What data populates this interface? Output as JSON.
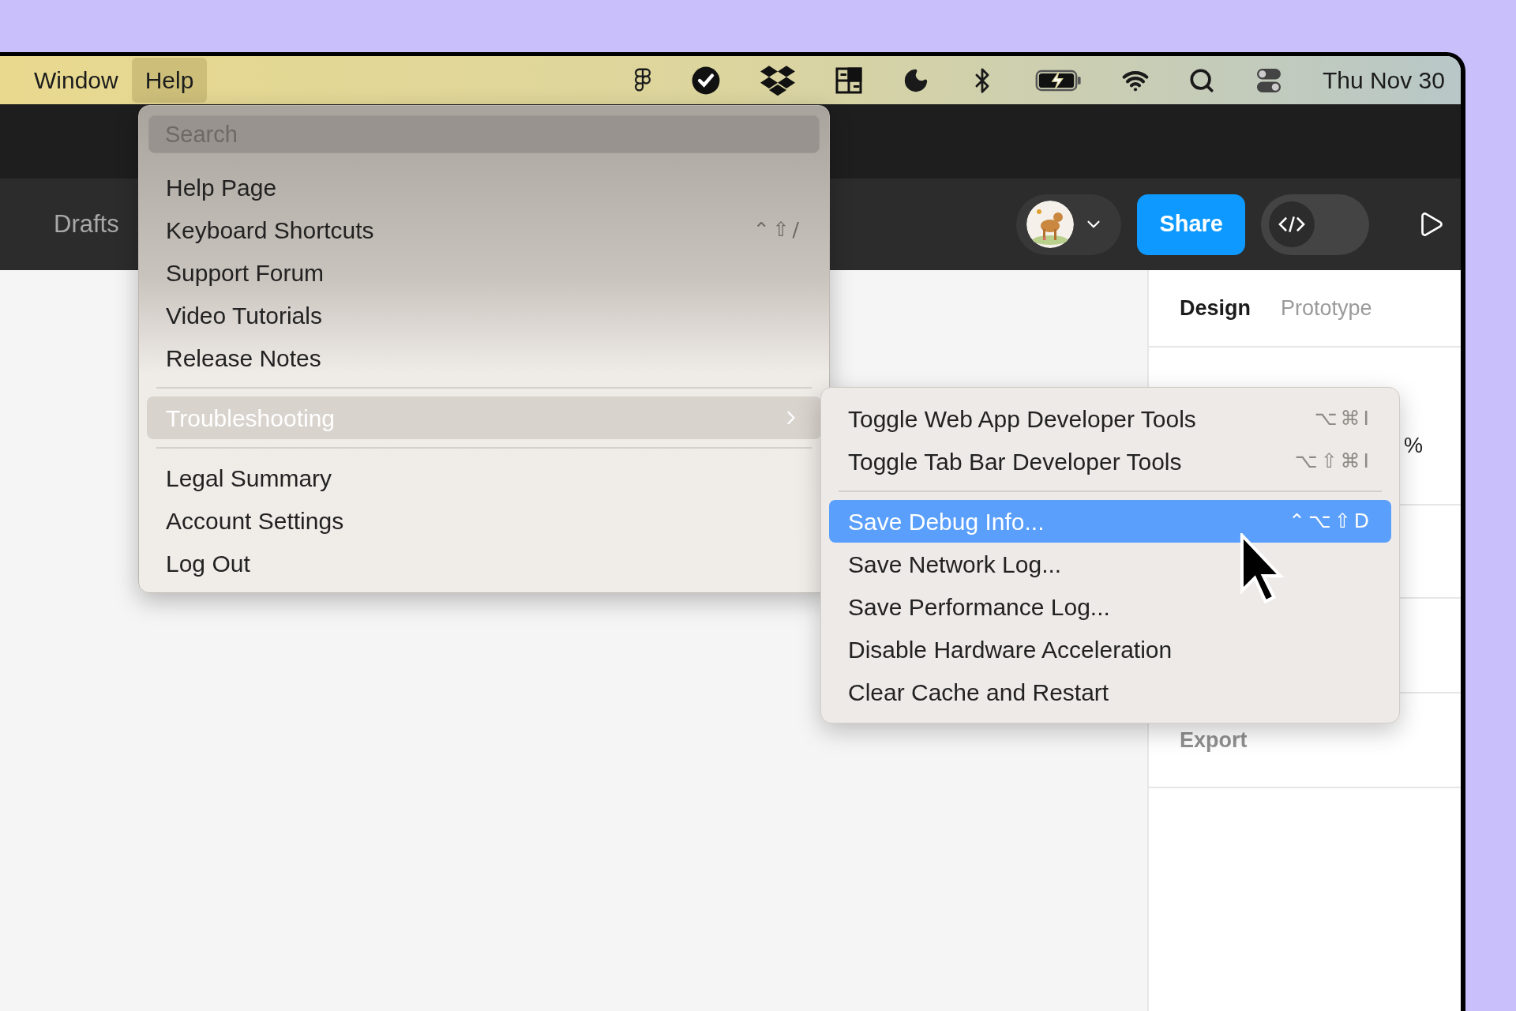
{
  "menu_bar": {
    "menus": [
      {
        "label": "Window",
        "selected": false
      },
      {
        "label": "Help",
        "selected": true
      }
    ],
    "clock": "Thu Nov 30"
  },
  "toolbar": {
    "breadcrumb": "Drafts",
    "share_button": "Share",
    "dev_mode": {
      "on": false
    }
  },
  "help_menu": {
    "search": {
      "placeholder": "Search"
    },
    "items": [
      {
        "kind": "item",
        "label": "Help Page",
        "selected": false
      },
      {
        "kind": "item",
        "label": "Keyboard Shortcuts",
        "shortcut": "⌃⇧/",
        "selected": false
      },
      {
        "kind": "item",
        "label": "Support Forum",
        "selected": false
      },
      {
        "kind": "item",
        "label": "Video Tutorials",
        "selected": false
      },
      {
        "kind": "item",
        "label": "Release Notes",
        "selected": false
      },
      {
        "kind": "separator"
      },
      {
        "kind": "submenu",
        "label": "Troubleshooting",
        "selected": true
      },
      {
        "kind": "separator"
      },
      {
        "kind": "item",
        "label": "Legal Summary",
        "selected": false
      },
      {
        "kind": "item",
        "label": "Account Settings",
        "selected": false
      },
      {
        "kind": "item",
        "label": "Log Out",
        "selected": false
      }
    ]
  },
  "troubleshooting_menu": {
    "items": [
      {
        "kind": "item",
        "label": "Toggle Web App Developer Tools",
        "shortcut": "⌥⌘I",
        "selected": false
      },
      {
        "kind": "item",
        "label": "Toggle Tab Bar Developer Tools",
        "shortcut": "⌥⇧⌘I",
        "selected": false
      },
      {
        "kind": "separator"
      },
      {
        "kind": "item",
        "label": "Save Debug Info...",
        "shortcut": "⌃⌥⇧D",
        "selected": true
      },
      {
        "kind": "item",
        "label": "Save Network Log...",
        "selected": false
      },
      {
        "kind": "item",
        "label": "Save Performance Log...",
        "selected": false
      },
      {
        "kind": "item",
        "label": "Disable Hardware Acceleration",
        "selected": false
      },
      {
        "kind": "item",
        "label": "Clear Cache and Restart",
        "selected": false
      }
    ]
  },
  "right_panel": {
    "tabs": [
      {
        "label": "Design",
        "selected": true
      },
      {
        "label": "Prototype",
        "selected": false
      }
    ],
    "partial_text": "%",
    "section": "Export"
  }
}
